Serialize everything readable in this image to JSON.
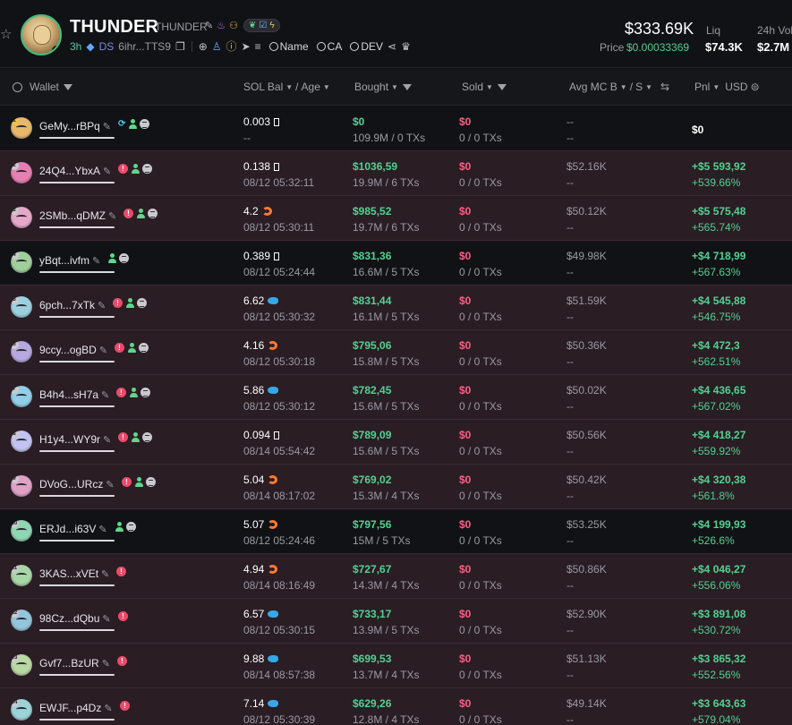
{
  "token": {
    "name": "THUNDER",
    "ticker": "THUNDER",
    "age": "3h",
    "ds": "DS",
    "address": "6ihr...TTS9",
    "links": {
      "name": "Name",
      "ca": "CA",
      "dev": "DEV"
    }
  },
  "stats": {
    "market_cap": "$333.69K",
    "price_label": "Price",
    "price": "$0.00033369",
    "liq_label": "Liq",
    "liq": "$74.3K",
    "vol_label": "24h Vol",
    "vol": "$2.7M"
  },
  "columns": {
    "wallet": "Wallet",
    "sol_bal": "SOL Bal",
    "age": "Age",
    "bought": "Bought",
    "sold": "Sold",
    "avg_mc": "Avg MC B",
    "avg_mc_s": "S",
    "pnl": "Pnl",
    "currency": "USD"
  },
  "colors": {
    "green": "#52d191",
    "red": "#ff5d86",
    "row_pink": "#2a1d24",
    "row_dark": "#111215"
  },
  "rows": [
    {
      "rank": "1",
      "wallet": "GeMy...rBPq",
      "tags": [
        "bot",
        "user",
        "list"
      ],
      "sol": "0.003",
      "sol_icon": "box",
      "age": "--",
      "bought": "$0",
      "bought_sub": "109.9M / 0 TXs",
      "sold": "$0",
      "sold_sub": "0 / 0 TXs",
      "avg": "--",
      "avg_sub": "--",
      "pnl": "$0",
      "pnl_pct": "",
      "bg": "dark",
      "av": "#e8b86a"
    },
    {
      "rank": "2",
      "wallet": "24Q4...YbxA",
      "tags": [
        "red",
        "user",
        "list"
      ],
      "sol": "0.138",
      "sol_icon": "box",
      "age": "08/12 05:32:11",
      "bought": "$1036,59",
      "bought_sub": "19.9M / 6 TXs",
      "sold": "$0",
      "sold_sub": "0 / 0 TXs",
      "avg": "$52.16K",
      "avg_sub": "--",
      "pnl": "+$5 593,92",
      "pnl_pct": "+539.66%",
      "bg": "pink",
      "av": "#e77fb3"
    },
    {
      "rank": "3",
      "wallet": "2SMb...qDMZ",
      "tags": [
        "red",
        "user",
        "list"
      ],
      "sol": "4.2",
      "sol_icon": "shrimp",
      "age": "08/12 05:30:11",
      "bought": "$985,52",
      "bought_sub": "19.7M / 6 TXs",
      "sold": "$0",
      "sold_sub": "0 / 0 TXs",
      "avg": "$50.12K",
      "avg_sub": "--",
      "pnl": "+$5 575,48",
      "pnl_pct": "+565.74%",
      "bg": "pink",
      "av": "#e6a7c9"
    },
    {
      "rank": "4",
      "wallet": "yBqt...ivfm",
      "tags": [
        "user",
        "list"
      ],
      "sol": "0.389",
      "sol_icon": "box",
      "age": "08/12 05:24:44",
      "bought": "$831,36",
      "bought_sub": "16.6M / 5 TXs",
      "sold": "$0",
      "sold_sub": "0 / 0 TXs",
      "avg": "$49.98K",
      "avg_sub": "--",
      "pnl": "+$4 718,99",
      "pnl_pct": "+567.63%",
      "bg": "dark",
      "av": "#9fcf9a"
    },
    {
      "rank": "5",
      "wallet": "6pch...7xTk",
      "tags": [
        "red",
        "user",
        "list"
      ],
      "sol": "6.62",
      "sol_icon": "fish",
      "age": "08/12 05:30:32",
      "bought": "$831,44",
      "bought_sub": "16.1M / 5 TXs",
      "sold": "$0",
      "sold_sub": "0 / 0 TXs",
      "avg": "$51.59K",
      "avg_sub": "--",
      "pnl": "+$4 545,88",
      "pnl_pct": "+546.75%",
      "bg": "pink",
      "av": "#9ad0df"
    },
    {
      "rank": "6",
      "wallet": "9ccy...ogBD",
      "tags": [
        "red",
        "user",
        "list"
      ],
      "sol": "4.16",
      "sol_icon": "shrimp",
      "age": "08/12 05:30:18",
      "bought": "$795,06",
      "bought_sub": "15.8M / 5 TXs",
      "sold": "$0",
      "sold_sub": "0 / 0 TXs",
      "avg": "$50.36K",
      "avg_sub": "--",
      "pnl": "+$4 472,3",
      "pnl_pct": "+562.51%",
      "bg": "pink",
      "av": "#b7a8e0"
    },
    {
      "rank": "7",
      "wallet": "B4h4...sH7a",
      "tags": [
        "red",
        "user",
        "list"
      ],
      "sol": "5.86",
      "sol_icon": "fish",
      "age": "08/12 05:30:12",
      "bought": "$782,45",
      "bought_sub": "15.6M / 5 TXs",
      "sold": "$0",
      "sold_sub": "0 / 0 TXs",
      "avg": "$50.02K",
      "avg_sub": "--",
      "pnl": "+$4 436,65",
      "pnl_pct": "+567.02%",
      "bg": "pink",
      "av": "#8fcfe7"
    },
    {
      "rank": "8",
      "wallet": "H1y4...WY9r",
      "tags": [
        "red",
        "user",
        "list"
      ],
      "sol": "0.094",
      "sol_icon": "box",
      "age": "08/14 05:54:42",
      "bought": "$789,09",
      "bought_sub": "15.6M / 5 TXs",
      "sold": "$0",
      "sold_sub": "0 / 0 TXs",
      "avg": "$50.56K",
      "avg_sub": "--",
      "pnl": "+$4 418,27",
      "pnl_pct": "+559.92%",
      "bg": "pink",
      "av": "#c2c3f0"
    },
    {
      "rank": "9",
      "wallet": "DVoG...URcz",
      "tags": [
        "red",
        "user",
        "list"
      ],
      "sol": "5.04",
      "sol_icon": "shrimp",
      "age": "08/14 08:17:02",
      "bought": "$769,02",
      "bought_sub": "15.3M / 4 TXs",
      "sold": "$0",
      "sold_sub": "0 / 0 TXs",
      "avg": "$50.42K",
      "avg_sub": "--",
      "pnl": "+$4 320,38",
      "pnl_pct": "+561.8%",
      "bg": "pink",
      "av": "#dfa1c5"
    },
    {
      "rank": "10",
      "wallet": "ERJd...i63V",
      "tags": [
        "user",
        "list"
      ],
      "sol": "5.07",
      "sol_icon": "shrimp",
      "age": "08/12 05:24:46",
      "bought": "$797,56",
      "bought_sub": "15M / 5 TXs",
      "sold": "$0",
      "sold_sub": "0 / 0 TXs",
      "avg": "$53.25K",
      "avg_sub": "--",
      "pnl": "+$4 199,93",
      "pnl_pct": "+526.6%",
      "bg": "dark",
      "av": "#8fd6b3"
    },
    {
      "rank": "11",
      "wallet": "3KAS...xVEt",
      "tags": [
        "red"
      ],
      "sol": "4.94",
      "sol_icon": "shrimp",
      "age": "08/14 08:16:49",
      "bought": "$727,67",
      "bought_sub": "14.3M / 4 TXs",
      "sold": "$0",
      "sold_sub": "0 / 0 TXs",
      "avg": "$50.86K",
      "avg_sub": "--",
      "pnl": "+$4 046,27",
      "pnl_pct": "+556.06%",
      "bg": "pink",
      "av": "#a8d7a6"
    },
    {
      "rank": "12",
      "wallet": "98Cz...dQbu",
      "tags": [
        "red"
      ],
      "sol": "6.57",
      "sol_icon": "fish",
      "age": "08/12 05:30:15",
      "bought": "$733,17",
      "bought_sub": "13.9M / 5 TXs",
      "sold": "$0",
      "sold_sub": "0 / 0 TXs",
      "avg": "$52.90K",
      "avg_sub": "--",
      "pnl": "+$3 891,08",
      "pnl_pct": "+530.72%",
      "bg": "pink",
      "av": "#93c6dc"
    },
    {
      "rank": "13",
      "wallet": "Gvf7...BzUR",
      "tags": [
        "red"
      ],
      "sol": "9.88",
      "sol_icon": "fish",
      "age": "08/14 08:57:38",
      "bought": "$699,53",
      "bought_sub": "13.7M / 4 TXs",
      "sold": "$0",
      "sold_sub": "0 / 0 TXs",
      "avg": "$51.13K",
      "avg_sub": "--",
      "pnl": "+$3 865,32",
      "pnl_pct": "+552.56%",
      "bg": "pink",
      "av": "#b9d8a2"
    },
    {
      "rank": "14",
      "wallet": "EWJF...p4Dz",
      "tags": [
        "red"
      ],
      "sol": "7.14",
      "sol_icon": "fish",
      "age": "08/12 05:30:39",
      "bought": "$629,26",
      "bought_sub": "12.8M / 4 TXs",
      "sold": "$0",
      "sold_sub": "0 / 0 TXs",
      "avg": "$49.14K",
      "avg_sub": "--",
      "pnl": "+$3 643,63",
      "pnl_pct": "+579.04%",
      "bg": "pink",
      "av": "#9bd3d9"
    }
  ]
}
